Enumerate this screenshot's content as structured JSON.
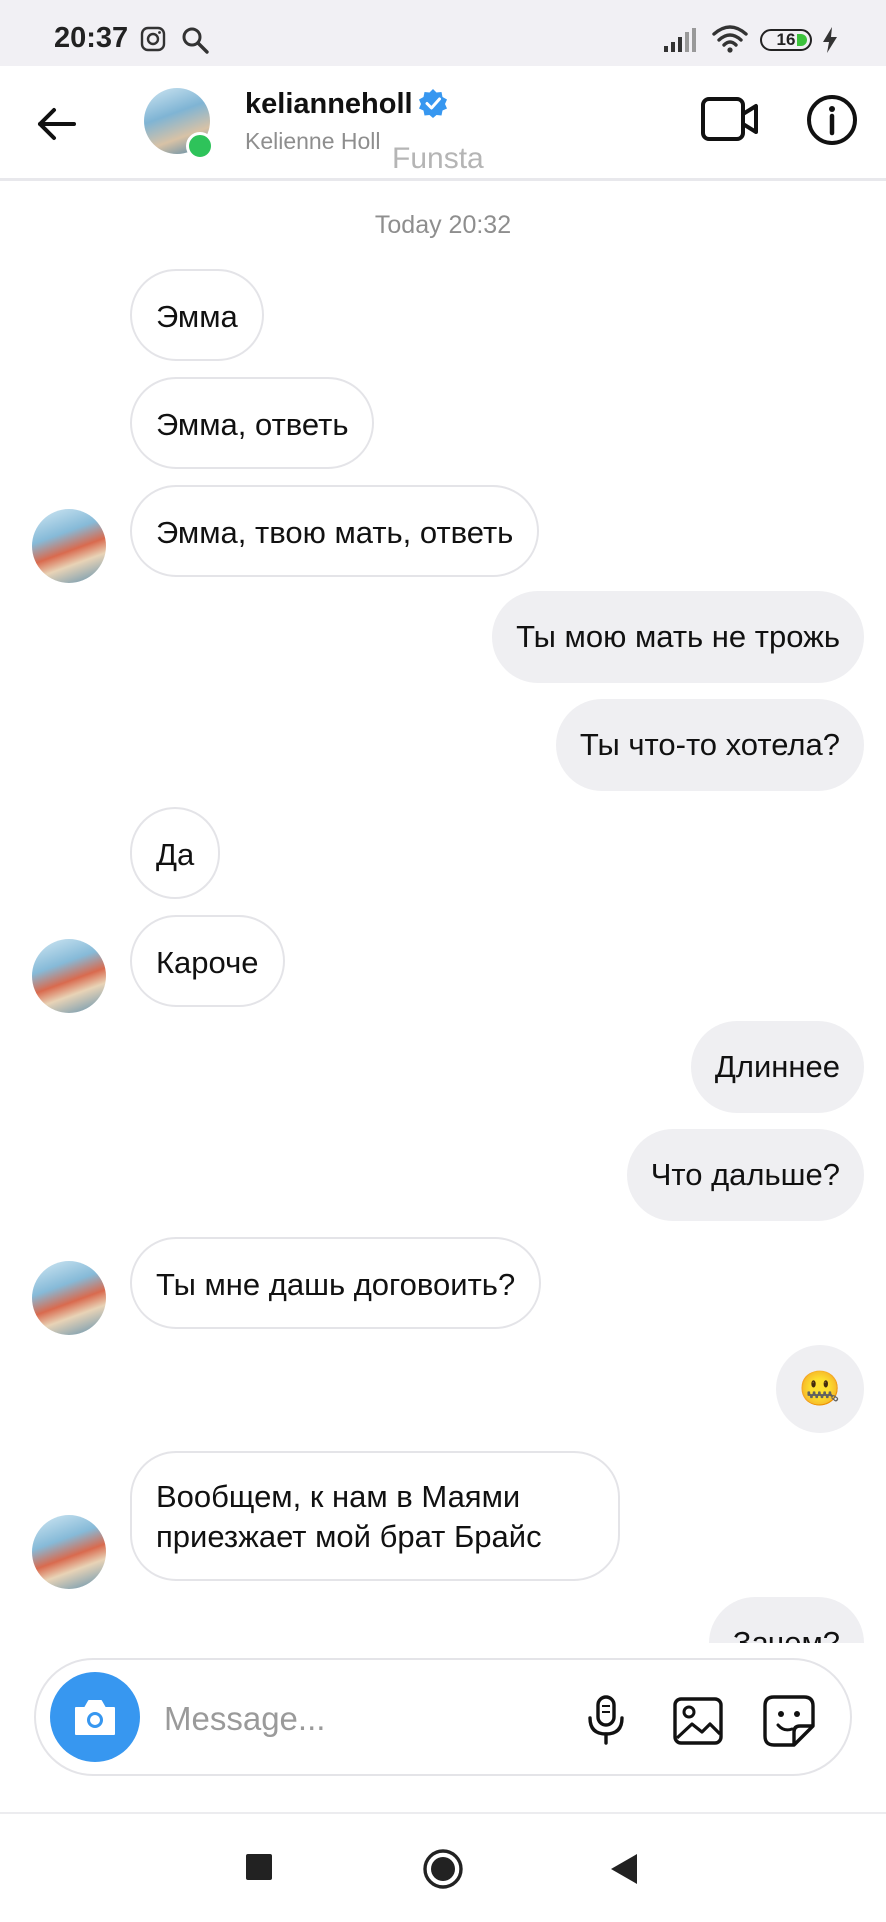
{
  "status_bar": {
    "time": "20:37",
    "battery": "16"
  },
  "header": {
    "username": "kelianneholl",
    "fullname": "Kelienne Holl",
    "watermark": "Funsta"
  },
  "chat": {
    "timestamp": "Today 20:32",
    "messages": [
      {
        "side": "in",
        "text": "Эмма"
      },
      {
        "side": "in",
        "text": "Эмма, ответь"
      },
      {
        "side": "in",
        "text": "Эмма, твою мать, ответь"
      },
      {
        "side": "out",
        "text": "Ты мою мать не трожь"
      },
      {
        "side": "out",
        "text": "Ты что-то хотела?"
      },
      {
        "side": "in",
        "text": "Да"
      },
      {
        "side": "in",
        "text": "Кароче"
      },
      {
        "side": "out",
        "text": "Длиннее"
      },
      {
        "side": "out",
        "text": "Что дальше?"
      },
      {
        "side": "in",
        "text": "Ты мне дашь договоить?"
      },
      {
        "side": "out",
        "text": "🤐"
      },
      {
        "side": "in",
        "text": "Вообщем, к нам  в Маями приезжает мой брат Брайс"
      },
      {
        "side": "out",
        "text": "Зачем?"
      }
    ]
  },
  "composer": {
    "placeholder": "Message..."
  },
  "icons": {
    "back": "arrow-left-icon",
    "video": "video-camera-icon",
    "info": "info-icon",
    "camera": "camera-icon",
    "mic": "microphone-icon",
    "gallery": "image-icon",
    "sticker": "sticker-icon"
  },
  "colors": {
    "accent": "#3797f0",
    "online": "#2ec35a",
    "outgoing_bubble": "#efeff2"
  }
}
